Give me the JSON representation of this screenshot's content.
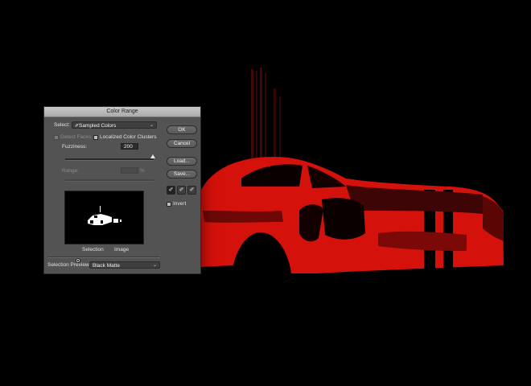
{
  "dialog": {
    "title": "Color Range",
    "select_label": "Select:",
    "select_value": "Sampled Colors",
    "select_icon": "eyedropper-icon",
    "detect_faces_label": "Detect Faces",
    "localized_label": "Localized Color Clusters",
    "fuzziness_label": "Fuzziness:",
    "fuzziness_value": "200",
    "range_label": "Range:",
    "range_unit": "%",
    "selection_label": "Selection",
    "image_label": "Image",
    "selection_preview_label": "Selection Preview:",
    "selection_preview_value": "Black Matte",
    "buttons": {
      "ok": "OK",
      "cancel": "Cancel",
      "load": "Load...",
      "save": "Save..."
    },
    "invert_label": "Invert",
    "tools": [
      "eyedropper-icon",
      "eyedropper-plus-icon",
      "eyedropper-minus-icon"
    ]
  },
  "colors": {
    "dialog_bg": "#535353",
    "car_red": "#e8120c",
    "background": "#000000"
  }
}
